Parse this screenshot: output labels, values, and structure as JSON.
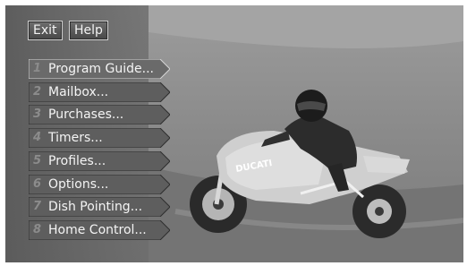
{
  "top_buttons": {
    "exit": "Exit",
    "help": "Help"
  },
  "menu": [
    {
      "num": "1",
      "label": "Program Guide..."
    },
    {
      "num": "2",
      "label": "Mailbox..."
    },
    {
      "num": "3",
      "label": "Purchases..."
    },
    {
      "num": "4",
      "label": "Timers..."
    },
    {
      "num": "5",
      "label": "Profiles..."
    },
    {
      "num": "6",
      "label": "Options..."
    },
    {
      "num": "7",
      "label": "Dish Pointing..."
    },
    {
      "num": "8",
      "label": "Home Control..."
    }
  ],
  "background": {
    "brand_text": "DUCATI",
    "tint": "#8b8b8b"
  }
}
